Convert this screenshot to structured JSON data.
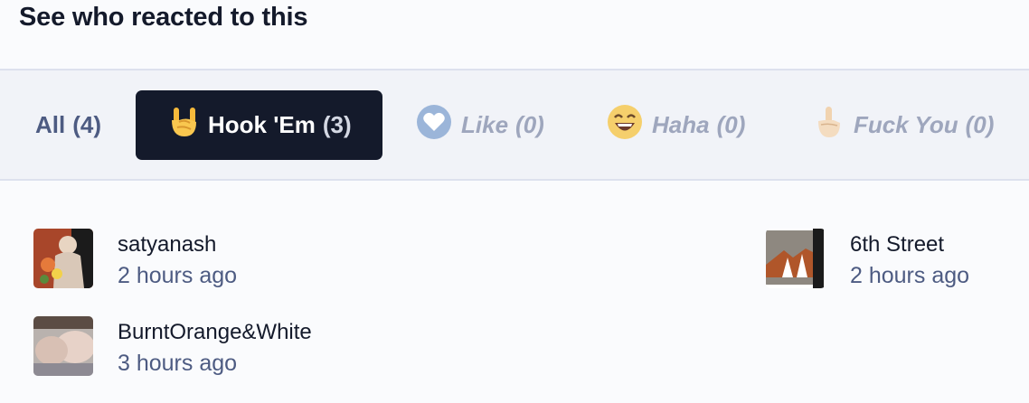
{
  "header": {
    "title": "See who reacted to this"
  },
  "tabs": [
    {
      "label": "All",
      "count": "(4)",
      "icon": "none",
      "selected": false
    },
    {
      "label": "Hook 'Em",
      "count": "(3)",
      "icon": "horns-hand-icon",
      "selected": true
    },
    {
      "label": "Like",
      "count": "(0)",
      "icon": "heart-icon",
      "selected": false
    },
    {
      "label": "Haha",
      "count": "(0)",
      "icon": "laughing-face-icon",
      "selected": false
    },
    {
      "label": "Fuck You",
      "count": "(0)",
      "icon": "middle-finger-icon",
      "selected": false
    }
  ],
  "users": [
    {
      "name": "satyanash",
      "time": "2 hours ago"
    },
    {
      "name": "BurntOrange&White",
      "time": "3 hours ago"
    },
    {
      "name": "6th Street",
      "time": "2 hours ago"
    }
  ],
  "colors": {
    "dark": "#141a2b",
    "muted": "#4d5b82",
    "disabled": "#9ea6bd",
    "tabbar_bg": "#f1f3f8"
  }
}
